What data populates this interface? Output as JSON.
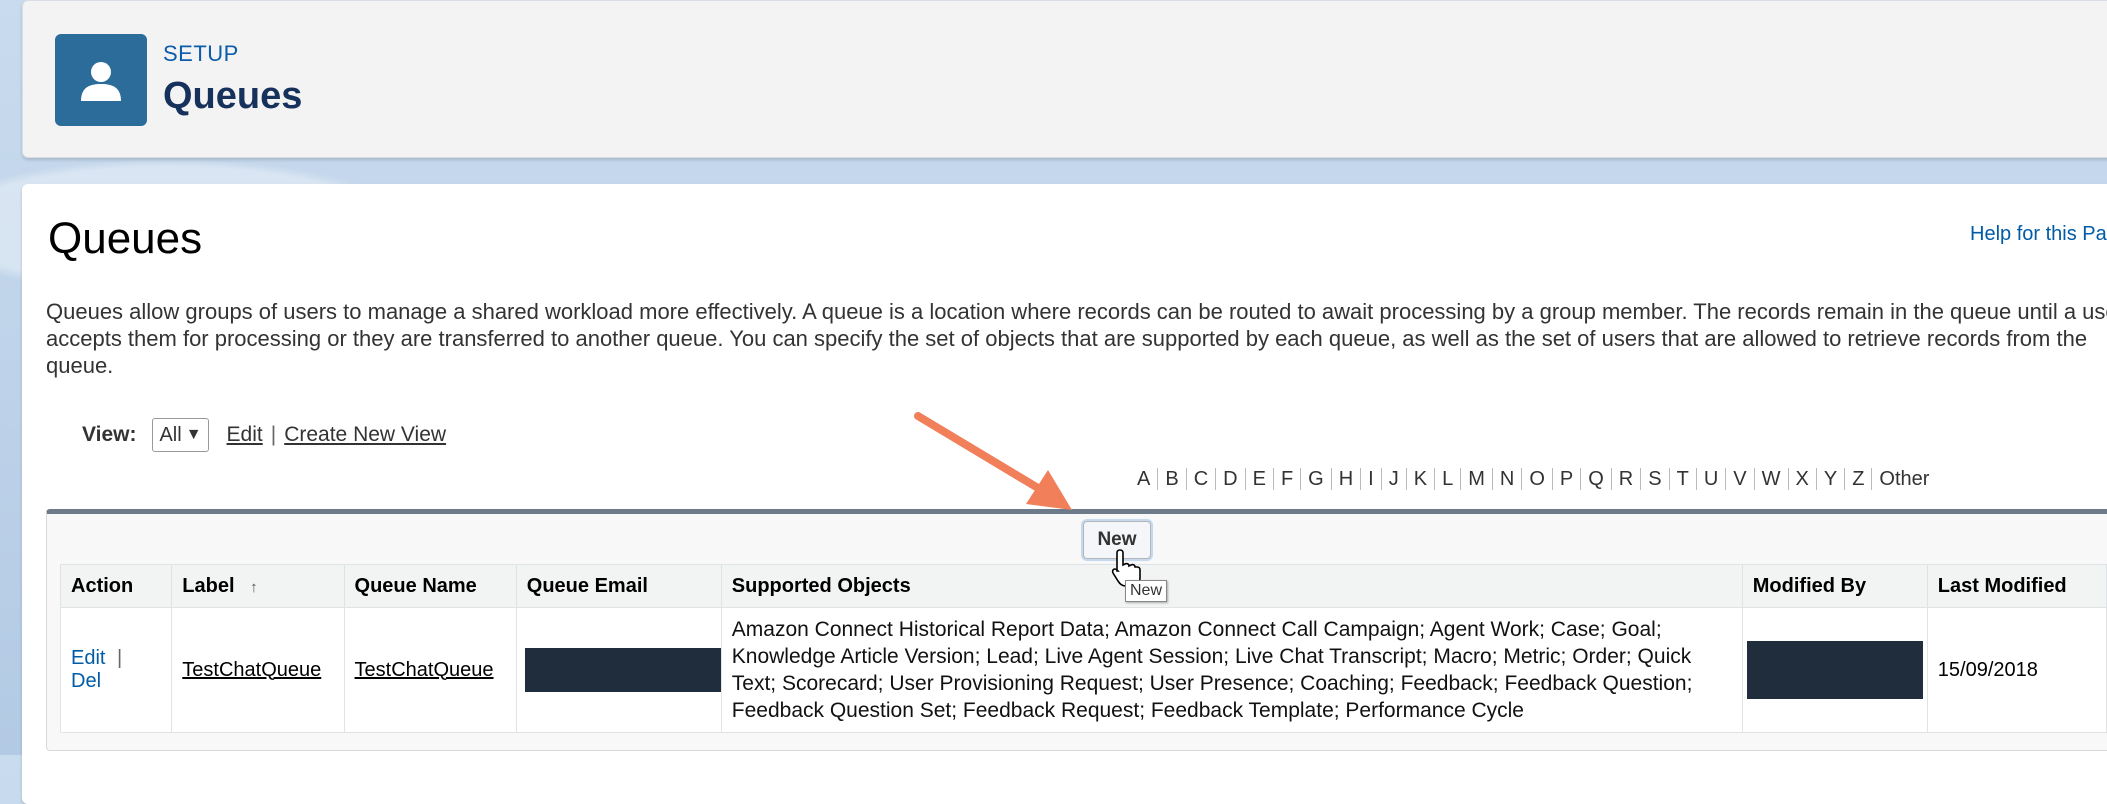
{
  "header": {
    "eyebrow": "SETUP",
    "title": "Queues",
    "icon": "user-icon"
  },
  "page": {
    "title": "Queues",
    "help_link": "Help for this Page",
    "description": "Queues allow groups of users to manage a shared workload more effectively. A queue is a location where records can be routed to await processing by a group member. The records remain in the queue until a user accepts them for processing or they are transferred to another queue. You can specify the set of objects that are supported by each queue, as well as the set of users that are allowed to retrieve records from the queue."
  },
  "view": {
    "label": "View:",
    "selected": "All",
    "edit_link": "Edit",
    "separator": "|",
    "create_link": "Create New View"
  },
  "alphabet": [
    "A",
    "B",
    "C",
    "D",
    "E",
    "F",
    "G",
    "H",
    "I",
    "J",
    "K",
    "L",
    "M",
    "N",
    "O",
    "P",
    "Q",
    "R",
    "S",
    "T",
    "U",
    "V",
    "W",
    "X",
    "Y",
    "Z",
    "Other"
  ],
  "list": {
    "new_button": "New",
    "tooltip": "New",
    "columns": {
      "action": "Action",
      "label": "Label",
      "sort_indicator": "↑",
      "queue_name": "Queue Name",
      "queue_email": "Queue Email",
      "supported_objects": "Supported Objects",
      "modified_by": "Modified By",
      "last_modified": "Last Modified"
    },
    "rows": [
      {
        "edit": "Edit",
        "separator": "|",
        "del": "Del",
        "label": "TestChatQueue",
        "queue_name": "TestChatQueue",
        "supported_objects": "Amazon Connect Historical Report Data; Amazon Connect Call Campaign; Agent Work; Case; Goal; Knowledge Article Version; Lead; Live Agent Session; Live Chat Transcript; Macro; Metric; Order; Quick Text; Scorecard; User Provisioning Request; User Presence; Coaching; Feedback; Feedback Question; Feedback Question Set; Feedback Request; Feedback Template; Performance Cycle",
        "last_modified": "15/09/2018"
      }
    ]
  },
  "colors": {
    "accent": "#0b5cab",
    "header_icon_bg": "#2b6c9b",
    "annotation_arrow": "#f07f5a",
    "redaction": "#1f2d3d"
  }
}
